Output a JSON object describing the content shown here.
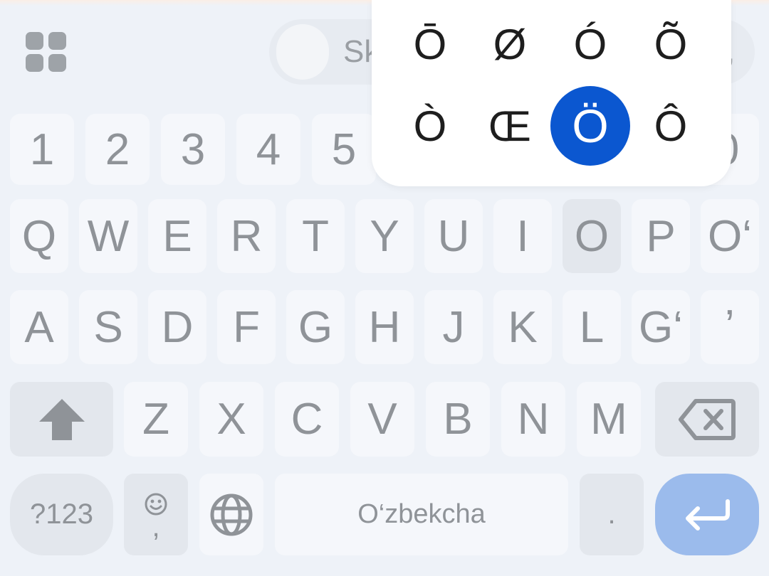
{
  "suggestion_bar": {
    "apps_icon": "grid-icon",
    "suggestion_partial": "Sk",
    "suggestion_trailing": ","
  },
  "number_row": [
    "1",
    "2",
    "3",
    "4",
    "5",
    "0"
  ],
  "row_q": [
    "Q",
    "W",
    "E",
    "R",
    "T",
    "Y",
    "U",
    "I",
    "O",
    "P",
    "O‘"
  ],
  "row_a": [
    "A",
    "S",
    "D",
    "F",
    "G",
    "H",
    "J",
    "K",
    "L",
    "G‘",
    "ʼ"
  ],
  "row_z": [
    "Z",
    "X",
    "C",
    "V",
    "B",
    "N",
    "M"
  ],
  "bottom_row": {
    "symbols_label": "?123",
    "emoji_comma_label": ",",
    "space_label": "O‘zbekcha",
    "period_label": "."
  },
  "icons": {
    "shift": "shift-arrow-icon",
    "backspace": "backspace-icon",
    "emoji": "smiley-icon",
    "globe": "globe-icon",
    "enter": "enter-arrow-icon"
  },
  "accent_popup": {
    "row1": [
      "Ō",
      "Ø",
      "Ó",
      "Õ"
    ],
    "row2": [
      "Ò",
      "Œ",
      "Ö",
      "Ô"
    ],
    "selected": "Ö"
  },
  "colors": {
    "background": "#eef2f8",
    "key": "#f5f7fb",
    "function_key": "#e3e7ed",
    "key_text": "#8f9398",
    "selected_accent": "#0b57d0",
    "enter_key": "#9bbbec"
  }
}
